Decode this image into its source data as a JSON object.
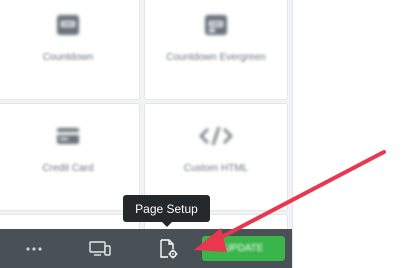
{
  "widgets": [
    {
      "label": "Countdown",
      "icon": "countdown-icon"
    },
    {
      "label": "Countdown Evergreen",
      "icon": "countdown-evergreen-icon"
    },
    {
      "label": "Credit Card",
      "icon": "credit-card-icon"
    },
    {
      "label": "Custom HTML",
      "icon": "code-icon"
    }
  ],
  "footer": {
    "more_icon": "ellipsis-icon",
    "responsive_icon": "desktop-icon",
    "page_setup_icon": "page-settings-icon",
    "update_label": "Update"
  },
  "tooltip": {
    "text": "Page Setup"
  },
  "colors": {
    "footer_bg": "#495157",
    "update_green": "#39b54a",
    "annotation_arrow": "#e8374f",
    "tooltip_bg": "#26292c"
  }
}
